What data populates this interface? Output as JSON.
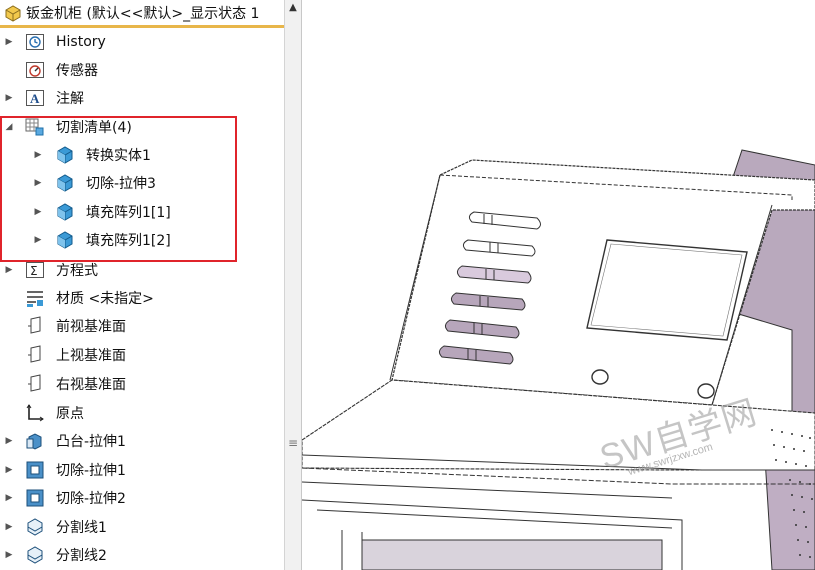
{
  "tree": {
    "header": "钣金机柜 (默认<<默认>_显示状态 1",
    "items": [
      {
        "label": "History",
        "icon": "history-icon",
        "expander": true
      },
      {
        "label": "传感器",
        "icon": "sensor-icon",
        "expander": false
      },
      {
        "label": "注解",
        "icon": "annotation-icon",
        "expander": true
      },
      {
        "label": "切割清单(4)",
        "icon": "cut-list-icon",
        "expander": "open"
      },
      {
        "label": "转换实体1",
        "icon": "solid-body-icon",
        "expander": true
      },
      {
        "label": "切除-拉伸3",
        "icon": "solid-body-icon",
        "expander": true
      },
      {
        "label": "填充阵列1[1]",
        "icon": "solid-body-icon",
        "expander": true
      },
      {
        "label": "填充阵列1[2]",
        "icon": "solid-body-icon",
        "expander": true
      },
      {
        "label": "方程式",
        "icon": "equation-icon",
        "expander": true
      },
      {
        "label": "材质 <未指定>",
        "icon": "material-icon",
        "expander": false
      },
      {
        "label": "前视基准面",
        "icon": "plane-icon",
        "expander": false
      },
      {
        "label": "上视基准面",
        "icon": "plane-icon",
        "expander": false
      },
      {
        "label": "右视基准面",
        "icon": "plane-icon",
        "expander": false
      },
      {
        "label": "原点",
        "icon": "origin-icon",
        "expander": false
      },
      {
        "label": "凸台-拉伸1",
        "icon": "boss-extrude-icon",
        "expander": true
      },
      {
        "label": "切除-拉伸1",
        "icon": "cut-extrude-icon",
        "expander": true
      },
      {
        "label": "切除-拉伸2",
        "icon": "cut-extrude-icon",
        "expander": true
      },
      {
        "label": "分割线1",
        "icon": "split-line-icon",
        "expander": true
      },
      {
        "label": "分割线2",
        "icon": "split-line-icon",
        "expander": true
      }
    ]
  },
  "watermark": {
    "big": "SW自学网",
    "small": "www.swrjzxw.com"
  },
  "colors": {
    "header_underline": "#e8b64a",
    "highlight_box": "#e0242b",
    "cabinet_side": "#b9a9bd",
    "slot_fill": "#b7a6bb"
  }
}
